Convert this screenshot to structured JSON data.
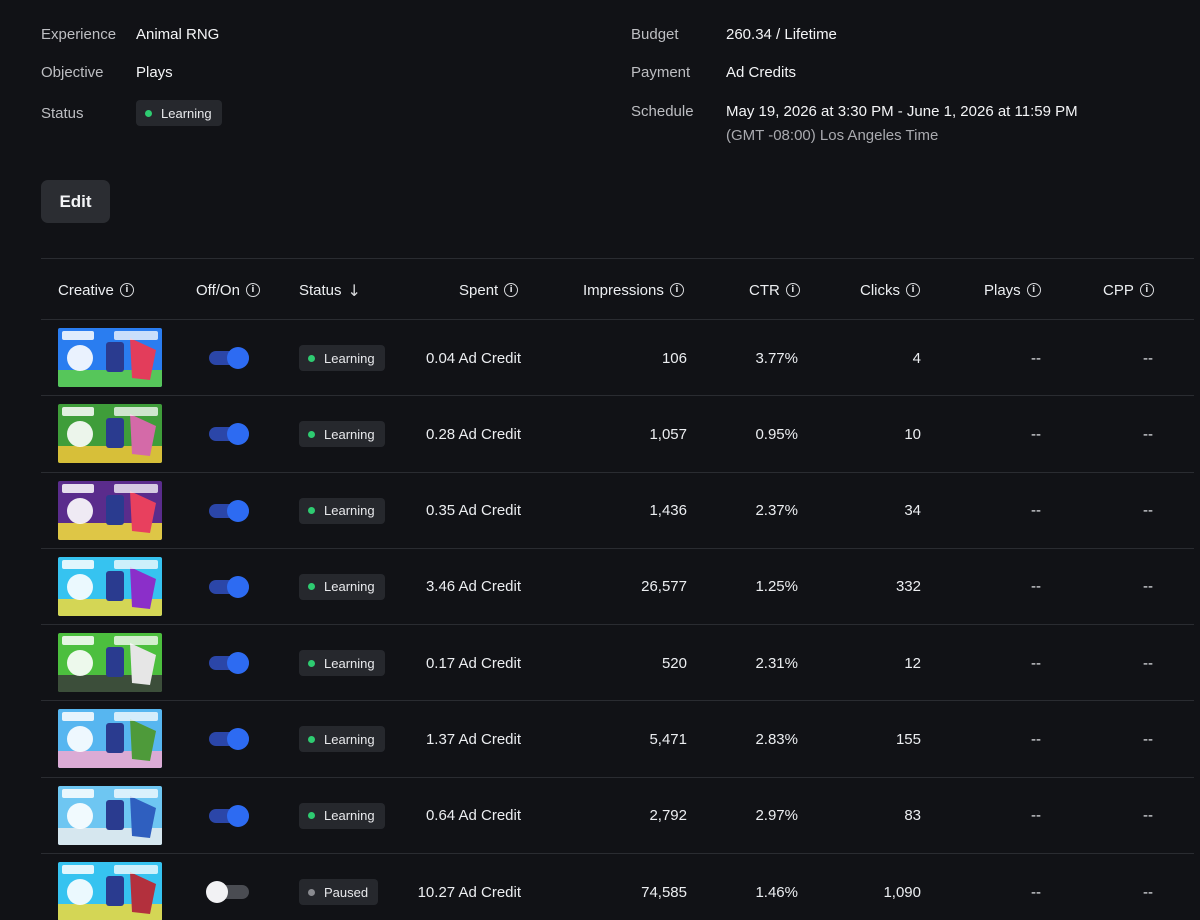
{
  "summary": {
    "experience_label": "Experience",
    "experience_value": "Animal RNG",
    "objective_label": "Objective",
    "objective_value": "Plays",
    "status_label": "Status",
    "status_value": "Learning",
    "budget_label": "Budget",
    "budget_value": "260.34 / Lifetime",
    "payment_label": "Payment",
    "payment_value": "Ad Credits",
    "schedule_label": "Schedule",
    "schedule_value": "May 19, 2026 at 3:30 PM - June 1, 2026 at 11:59 PM",
    "schedule_timezone": "(GMT -08:00) Los Angeles Time"
  },
  "edit_label": "Edit",
  "colors": {
    "learning_dot": "#2ecc71",
    "paused_dot": "#8a8b90",
    "toggle_on": "#2d6bf2"
  },
  "table": {
    "headers": {
      "creative": "Creative",
      "offon": "Off/On",
      "status": "Status",
      "spent": "Spent",
      "impressions": "Impressions",
      "ctr": "CTR",
      "clicks": "Clicks",
      "plays": "Plays",
      "cpp": "CPP"
    },
    "rows": [
      {
        "on": true,
        "status": "Learning",
        "spent": "0.04 Ad Credit",
        "impressions": "106",
        "ctr": "3.77%",
        "clicks": "4",
        "plays": "--",
        "cpp": "--",
        "thumb_colors": [
          "#2a7df0",
          "#e33d5b",
          "#5ed23f"
        ]
      },
      {
        "on": true,
        "status": "Learning",
        "spent": "0.28 Ad Credit",
        "impressions": "1,057",
        "ctr": "0.95%",
        "clicks": "10",
        "plays": "--",
        "cpp": "--",
        "thumb_colors": [
          "#3f9d3a",
          "#d46aa8",
          "#f2c53a"
        ]
      },
      {
        "on": true,
        "status": "Learning",
        "spent": "0.35 Ad Credit",
        "impressions": "1,436",
        "ctr": "2.37%",
        "clicks": "34",
        "plays": "--",
        "cpp": "--",
        "thumb_colors": [
          "#5a2c8c",
          "#e8405e",
          "#f6e23a"
        ]
      },
      {
        "on": true,
        "status": "Learning",
        "spent": "3.46 Ad Credit",
        "impressions": "26,577",
        "ctr": "1.25%",
        "clicks": "332",
        "plays": "--",
        "cpp": "--",
        "thumb_colors": [
          "#36c3f0",
          "#8b2fc9",
          "#f0d93a"
        ]
      },
      {
        "on": true,
        "status": "Learning",
        "spent": "0.17 Ad Credit",
        "impressions": "520",
        "ctr": "2.31%",
        "clicks": "12",
        "plays": "--",
        "cpp": "--",
        "thumb_colors": [
          "#4cbf3e",
          "#e6e6e6",
          "#3a3a3a"
        ]
      },
      {
        "on": true,
        "status": "Learning",
        "spent": "1.37 Ad Credit",
        "impressions": "5,471",
        "ctr": "2.83%",
        "clicks": "155",
        "plays": "--",
        "cpp": "--",
        "thumb_colors": [
          "#57b6f0",
          "#4e9a3a",
          "#f2a9d0"
        ]
      },
      {
        "on": true,
        "status": "Learning",
        "spent": "0.64 Ad Credit",
        "impressions": "2,792",
        "ctr": "2.97%",
        "clicks": "83",
        "plays": "--",
        "cpp": "--",
        "thumb_colors": [
          "#6ec6f2",
          "#2f5fbf",
          "#e9ecef"
        ]
      },
      {
        "on": false,
        "status": "Paused",
        "spent": "10.27 Ad Credit",
        "impressions": "74,585",
        "ctr": "1.46%",
        "clicks": "1,090",
        "plays": "--",
        "cpp": "--",
        "thumb_colors": [
          "#36c3f0",
          "#b3303d",
          "#f0d93a"
        ]
      }
    ]
  }
}
